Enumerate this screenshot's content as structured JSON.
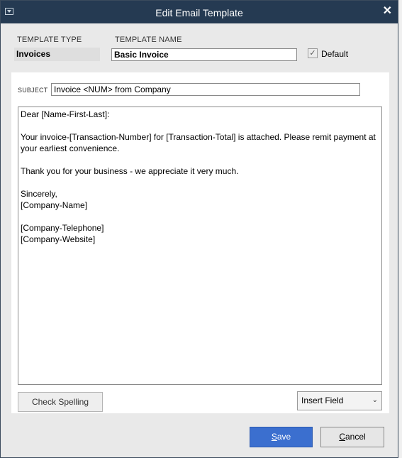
{
  "window": {
    "title": "Edit Email Template",
    "close_glyph": "✕"
  },
  "template": {
    "type_label": "TEMPLATE TYPE",
    "type_value": "Invoices",
    "name_label": "TEMPLATE NAME",
    "name_value": "Basic Invoice",
    "default_checked": true,
    "default_label": "Default"
  },
  "subject": {
    "label": "SUBJECT",
    "value": "Invoice <NUM> from Company"
  },
  "body_lines": [
    "Dear [Name-First-Last]:",
    "",
    "Your invoice-[Transaction-Number] for [Transaction-Total] is attached. Please remit payment at",
    "your earliest convenience.",
    "",
    "Thank you for your business - we appreciate it very much.",
    "",
    "Sincerely,",
    "[Company-Name]",
    "",
    "[Company-Telephone]",
    "[Company-Website]"
  ],
  "buttons": {
    "check_spelling": "Check Spelling",
    "insert_field": "Insert Field",
    "save_accel": "S",
    "save_rest": "ave",
    "cancel_accel": "C",
    "cancel_rest": "ancel"
  },
  "icons": {
    "system_menu": "system-menu-icon",
    "close": "close-icon",
    "check": "checkmark-icon",
    "dropdown": "chevron-down-icon"
  },
  "colors": {
    "titlebar": "#253a52",
    "primary_button": "#3b6fcf"
  }
}
